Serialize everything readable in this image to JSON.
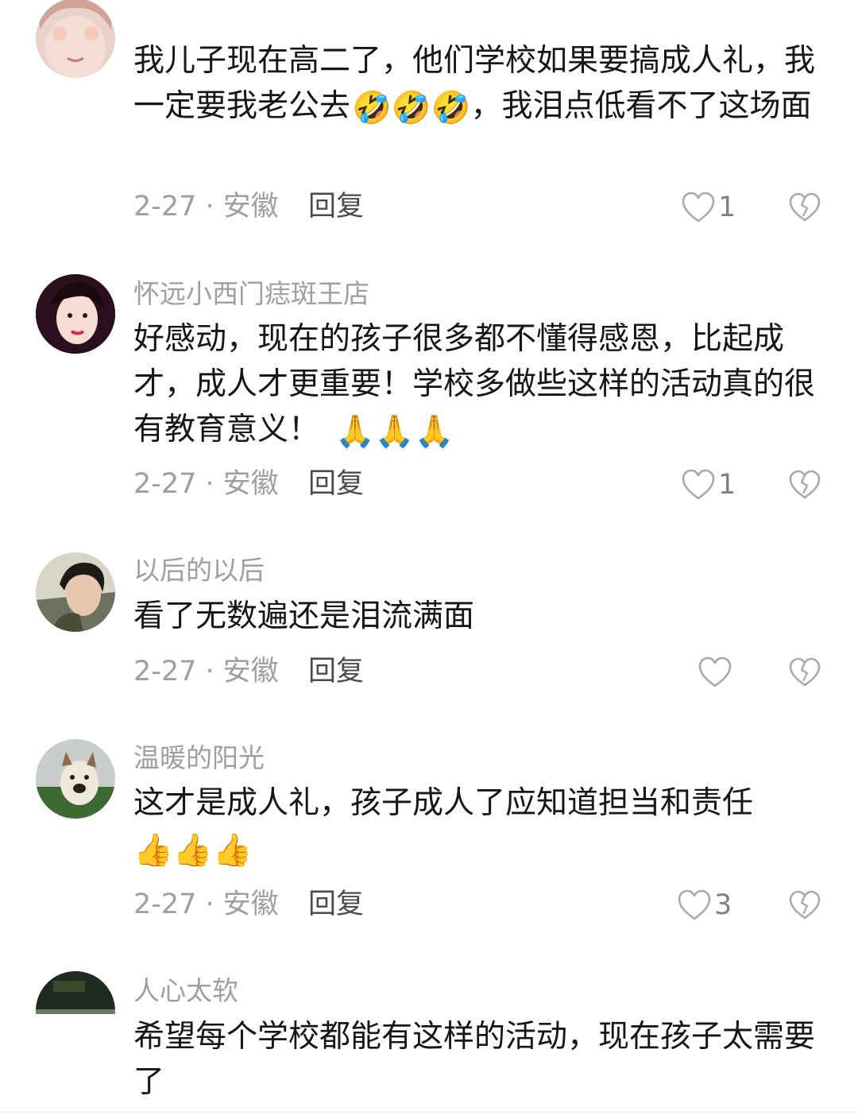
{
  "comments": [
    {
      "username": "",
      "text": "我儿子现在高二了，他们学校如果要搞成人礼，我一定要我老公去",
      "emoji": "🤣🤣🤣",
      "text_after": "，我泪点低看不了这场面",
      "meta": "2-27 · 安徽",
      "reply": "回复",
      "likes": "1"
    },
    {
      "username": "怀远小西门痣斑王店",
      "text": "好感动，现在的孩子很多都不懂得感恩，比起成才，成人才更重要！学校多做些这样的活动真的很有教育意义！",
      "emoji": "🙏🙏🙏",
      "meta": "2-27 · 安徽",
      "reply": "回复",
      "likes": "1"
    },
    {
      "username": "以后的以后",
      "text": "看了无数遍还是泪流满面",
      "meta": "2-27 · 安徽",
      "reply": "回复",
      "likes": ""
    },
    {
      "username": "温暖的阳光",
      "text": "这才是成人礼，孩子成人了应知道担当和责任",
      "emoji": "👍👍👍",
      "meta": "2-27 · 安徽",
      "reply": "回复",
      "likes": "3"
    },
    {
      "username": "人心太软",
      "text": "希望每个学校都能有这样的活动，现在孩子太需要了"
    }
  ],
  "icons": {
    "like": "heart-outline-icon",
    "dislike": "broken-heart-icon"
  }
}
